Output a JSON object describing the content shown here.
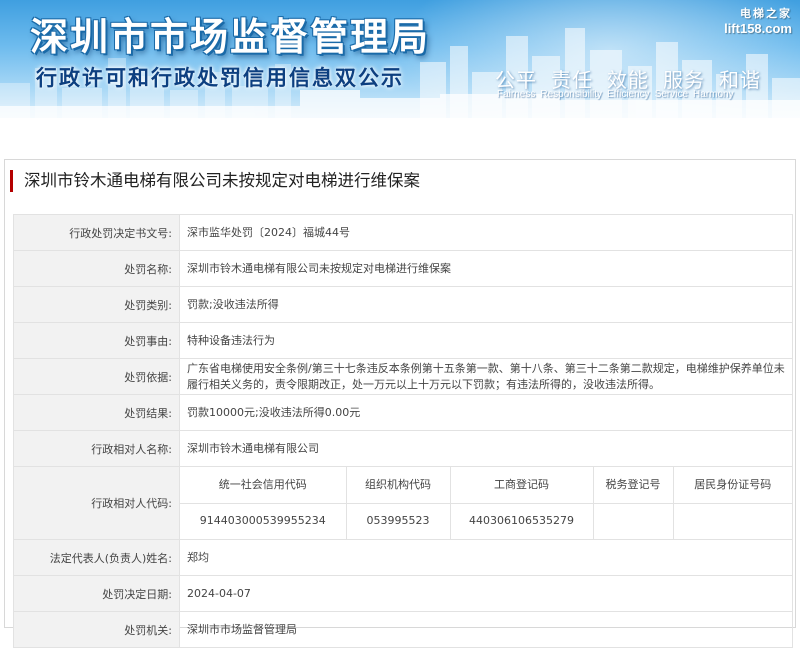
{
  "banner": {
    "title": "深圳市市场监督管理局",
    "subtitle": "行政许可和行政处罚信用信息双公示",
    "motto": [
      "公平",
      "责任",
      "效能",
      "服务",
      "和谐"
    ],
    "motto_en": [
      "Fairness",
      "Responsibility",
      "Efficiency",
      "Service",
      "Harmony"
    ],
    "watermark_cn": "电梯之家",
    "watermark_url": "lift158.com"
  },
  "case_title": "深圳市铃木通电梯有限公司未按规定对电梯进行维保案",
  "fields": {
    "decision_no": {
      "label": "行政处罚决定书文号:",
      "value": "深市监华处罚〔2024〕福城44号"
    },
    "penalty_name": {
      "label": "处罚名称:",
      "value": "深圳市铃木通电梯有限公司未按规定对电梯进行维保案"
    },
    "penalty_type": {
      "label": "处罚类别:",
      "value": "罚款;没收违法所得"
    },
    "penalty_reason": {
      "label": "处罚事由:",
      "value": "特种设备违法行为"
    },
    "penalty_basis": {
      "label": "处罚依据:",
      "value": "广东省电梯使用安全条例/第三十七条违反本条例第十五条第一款、第十八条、第三十二条第二款规定，电梯维护保养单位未履行相关义务的，责令限期改正，处一万元以上十万元以下罚款；有违法所得的，没收违法所得。"
    },
    "penalty_result": {
      "label": "处罚结果:",
      "value": "罚款10000元;没收违法所得0.00元"
    },
    "party_name": {
      "label": "行政相对人名称:",
      "value": "深圳市铃木通电梯有限公司"
    },
    "party_code": {
      "label": "行政相对人代码:",
      "headers": [
        "统一社会信用代码",
        "组织机构代码",
        "工商登记码",
        "税务登记号",
        "居民身份证号码"
      ],
      "values": [
        "914403000539955234",
        "053995523",
        "440306106535279",
        "",
        ""
      ]
    },
    "legal_rep": {
      "label": "法定代表人(负责人)姓名:",
      "value": "郑均"
    },
    "decision_date": {
      "label": "处罚决定日期:",
      "value": "2024-04-07"
    },
    "authority": {
      "label": "处罚机关:",
      "value": "深圳市市场监督管理局"
    }
  },
  "colors": {
    "accent_bar": "#b40000",
    "label_bg": "#f2f2f2",
    "border": "#e2e2e2",
    "banner_title_outline": "#1a6aa8",
    "banner_subtitle": "#0d3f80"
  }
}
